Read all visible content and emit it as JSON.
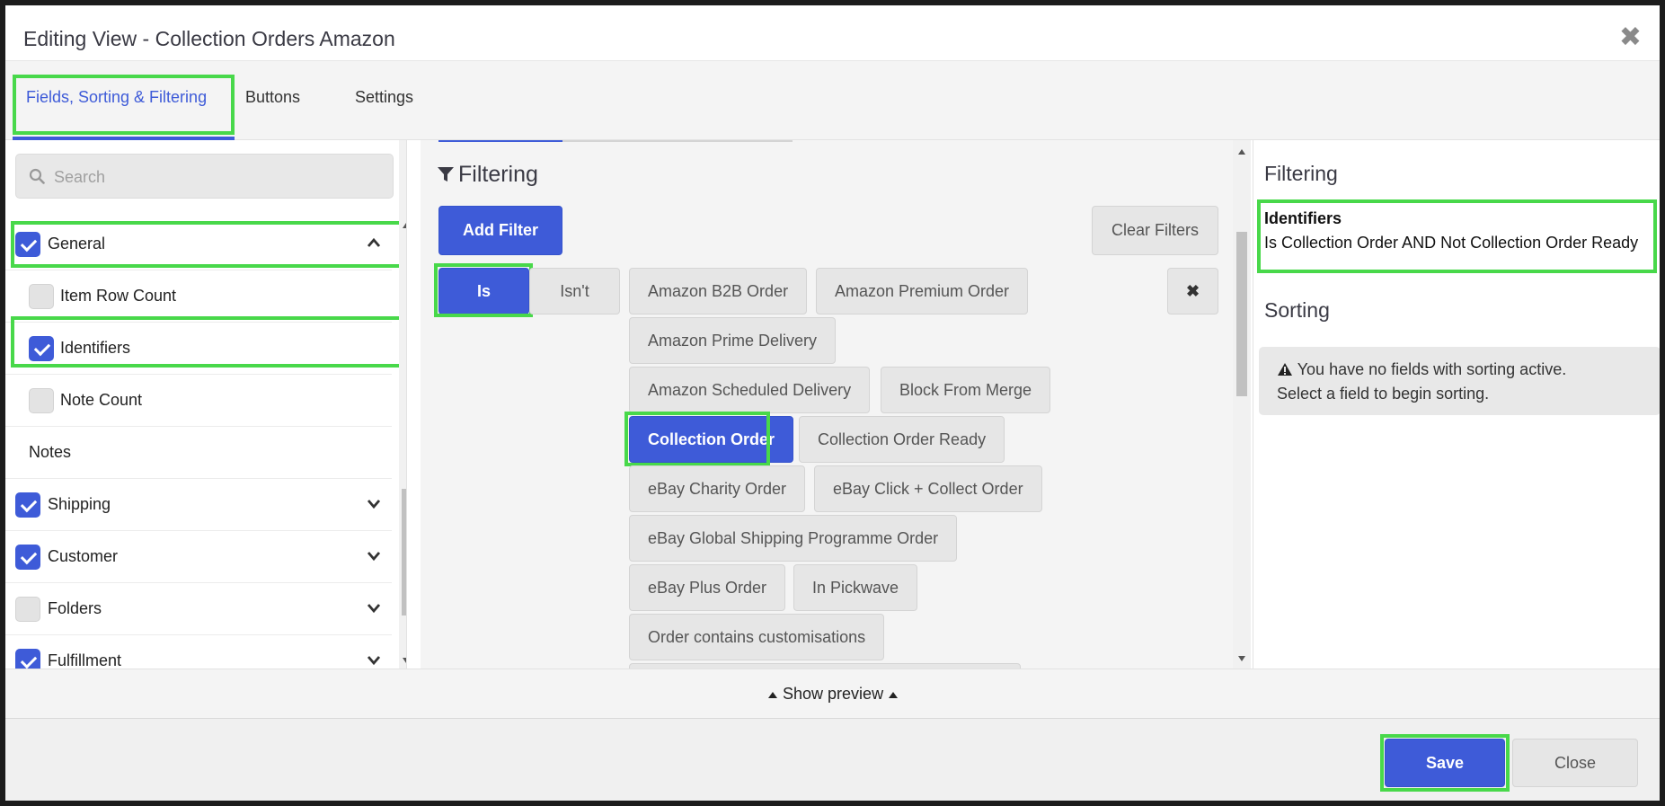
{
  "header": {
    "title": "Editing View - Collection Orders Amazon",
    "close_glyph": "✖"
  },
  "tabs": [
    {
      "label": "Fields, Sorting & Filtering",
      "active": true
    },
    {
      "label": "Buttons",
      "active": false
    },
    {
      "label": "Settings",
      "active": false
    }
  ],
  "search": {
    "placeholder": "Search",
    "value": ""
  },
  "field_groups": {
    "general": {
      "label": "General",
      "checked": true,
      "expanded": true
    },
    "sub_items": [
      {
        "label": "Item Row Count",
        "checked": false
      },
      {
        "label": "Identifiers",
        "checked": true
      },
      {
        "label": "Note Count",
        "checked": false
      },
      {
        "label": "Notes",
        "checked": false
      }
    ],
    "shipping": {
      "label": "Shipping",
      "checked": true
    },
    "customer": {
      "label": "Customer",
      "checked": true
    },
    "folders": {
      "label": "Folders",
      "checked": false
    },
    "fulfillment": {
      "label": "Fulfillment",
      "checked": true
    }
  },
  "filtering": {
    "title": "Filtering",
    "add_filter": "Add Filter",
    "clear_filters": "Clear Filters",
    "is_label": "Is",
    "isnt_label": "Isn't",
    "remove_glyph": "✖",
    "options": [
      {
        "label": "Amazon B2B Order",
        "selected": false
      },
      {
        "label": "Amazon Premium Order",
        "selected": false
      },
      {
        "label": "Amazon Prime Delivery",
        "selected": false
      },
      {
        "label": "Amazon Scheduled Delivery",
        "selected": false
      },
      {
        "label": "Block From Merge",
        "selected": false
      },
      {
        "label": "Collection Order",
        "selected": true
      },
      {
        "label": "Collection Order Ready",
        "selected": false
      },
      {
        "label": "eBay Charity Order",
        "selected": false
      },
      {
        "label": "eBay Click + Collect Order",
        "selected": false
      },
      {
        "label": "eBay Global Shipping Programme Order",
        "selected": false
      },
      {
        "label": "eBay Plus Order",
        "selected": false
      },
      {
        "label": "In Pickwave",
        "selected": false
      },
      {
        "label": "Order contains customisations",
        "selected": false
      }
    ]
  },
  "summary": {
    "filtering_title": "Filtering",
    "field": "Identifiers",
    "expression": "Is Collection Order AND Not Collection Order Ready",
    "sorting_title": "Sorting",
    "sorting_line1": "You have no fields with sorting active.",
    "sorting_line2": "Select a field to begin sorting."
  },
  "preview": {
    "label": "Show preview"
  },
  "footer": {
    "save_label": "Save",
    "close_label": "Close"
  },
  "colors": {
    "accent": "#3e5bd8",
    "highlight": "#48d84a"
  }
}
